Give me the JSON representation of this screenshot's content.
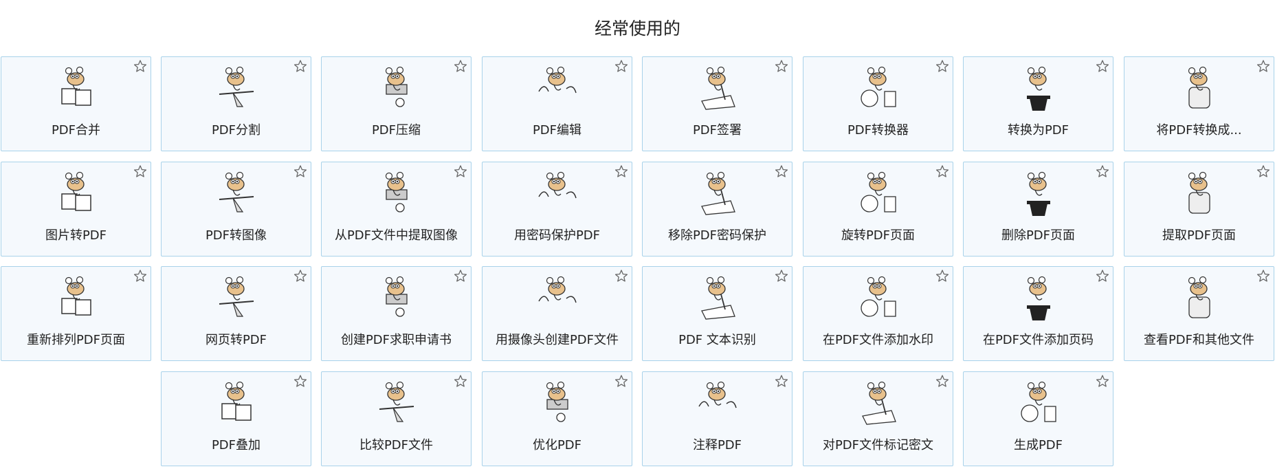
{
  "section_title": "经常使用的",
  "tools": [
    {
      "label": "PDF合并",
      "icon": "merge-icon"
    },
    {
      "label": "PDF分割",
      "icon": "split-icon"
    },
    {
      "label": "PDF压缩",
      "icon": "compress-icon"
    },
    {
      "label": "PDF编辑",
      "icon": "edit-icon"
    },
    {
      "label": "PDF签署",
      "icon": "sign-icon"
    },
    {
      "label": "PDF转换器",
      "icon": "converter-icon"
    },
    {
      "label": "转换为PDF",
      "icon": "convert-to-pdf-icon"
    },
    {
      "label": "将PDF转换成...",
      "icon": "convert-from-pdf-icon"
    },
    {
      "label": "图片转PDF",
      "icon": "image-to-pdf-icon"
    },
    {
      "label": "PDF转图像",
      "icon": "pdf-to-image-icon"
    },
    {
      "label": "从PDF文件中提取图像",
      "icon": "extract-images-icon"
    },
    {
      "label": "用密码保护PDF",
      "icon": "protect-icon"
    },
    {
      "label": "移除PDF密码保护",
      "icon": "unlock-icon"
    },
    {
      "label": "旋转PDF页面",
      "icon": "rotate-icon"
    },
    {
      "label": "删除PDF页面",
      "icon": "delete-pages-icon"
    },
    {
      "label": "提取PDF页面",
      "icon": "extract-pages-icon"
    },
    {
      "label": "重新排列PDF页面",
      "icon": "rearrange-icon"
    },
    {
      "label": "网页转PDF",
      "icon": "webpage-icon"
    },
    {
      "label": "创建PDF求职申请书",
      "icon": "job-application-icon"
    },
    {
      "label": "用摄像头创建PDF文件",
      "icon": "camera-icon"
    },
    {
      "label": "PDF 文本识别",
      "icon": "ocr-icon"
    },
    {
      "label": "在PDF文件添加水印",
      "icon": "watermark-icon"
    },
    {
      "label": "在PDF文件添加页码",
      "icon": "page-numbers-icon"
    },
    {
      "label": "查看PDF和其他文件",
      "icon": "viewer-icon"
    },
    {
      "label": "PDF叠加",
      "icon": "overlay-icon"
    },
    {
      "label": "比较PDF文件",
      "icon": "compare-icon"
    },
    {
      "label": "优化PDF",
      "icon": "optimize-icon"
    },
    {
      "label": "注释PDF",
      "icon": "annotate-icon"
    },
    {
      "label": "对PDF文件标记密文",
      "icon": "redact-icon"
    },
    {
      "label": "生成PDF",
      "icon": "create-icon"
    }
  ],
  "colors": {
    "card_border": "#a8d2ea",
    "card_bg": "#f5f9fd",
    "accent": "#e3b87a"
  }
}
